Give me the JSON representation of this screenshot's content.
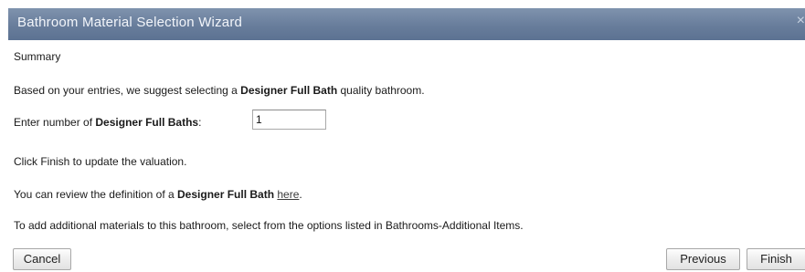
{
  "window": {
    "title": "Bathroom Material Selection Wizard",
    "close_glyph": "×"
  },
  "content": {
    "heading": "Summary",
    "suggestion": {
      "prefix": "Based on your entries, we suggest selecting a ",
      "bold": "Designer Full Bath",
      "suffix": " quality bathroom."
    },
    "quantity": {
      "prefix": "Enter number of ",
      "bold": "Designer Full Baths",
      "suffix": ":",
      "value": "1"
    },
    "finish_note": "Click Finish to update the valuation.",
    "review": {
      "prefix": "You can review the definition of a ",
      "bold": "Designer Full Bath",
      "space": " ",
      "link": "here",
      "suffix": "."
    },
    "additional": "To add additional materials to this bathroom, select from the options listed in Bathrooms-Additional Items."
  },
  "buttons": {
    "cancel": "Cancel",
    "previous": "Previous",
    "finish": "Finish"
  }
}
